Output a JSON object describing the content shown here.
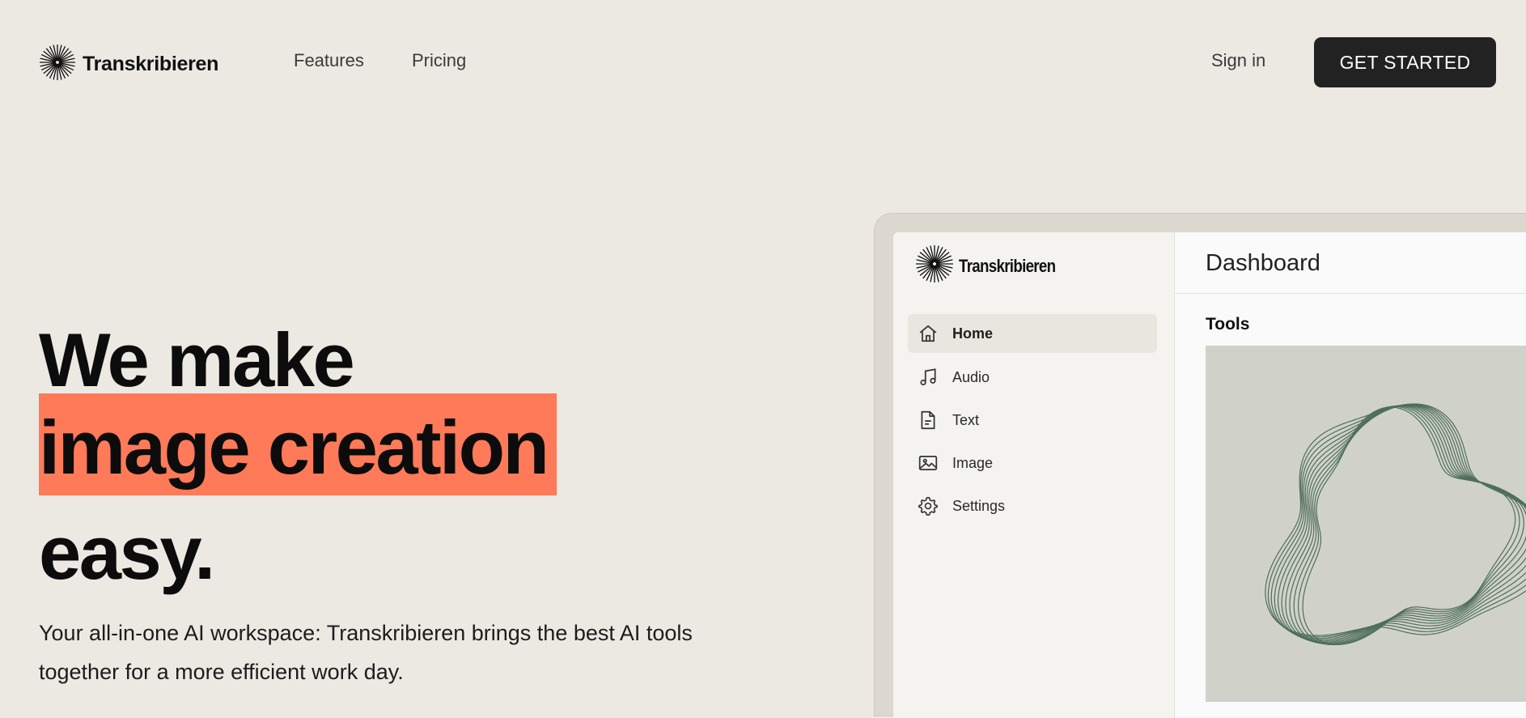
{
  "nav": {
    "brand": "Transkribieren",
    "links": [
      "Features",
      "Pricing"
    ],
    "sign_in": "Sign in",
    "cta": "GET STARTED"
  },
  "hero": {
    "line1": "We make",
    "highlight": "image creation",
    "line3": "easy.",
    "description": "Your all-in-one AI workspace: Transkribieren brings the best AI tools together for a more efficient work day.",
    "highlight_color": "#ff7a59"
  },
  "app": {
    "brand": "Transkribieren",
    "sidebar": [
      {
        "label": "Home",
        "icon": "home-icon",
        "active": true
      },
      {
        "label": "Audio",
        "icon": "music-note-icon",
        "active": false
      },
      {
        "label": "Text",
        "icon": "document-icon",
        "active": false
      },
      {
        "label": "Image",
        "icon": "image-icon",
        "active": false
      },
      {
        "label": "Settings",
        "icon": "gear-icon",
        "active": false
      }
    ],
    "header_title": "Dashboard",
    "section_title": "Tools"
  },
  "colors": {
    "background": "#ece9e2",
    "cta_bg": "#222222",
    "card_bg": "#d0d2ca",
    "wave_stroke": "#4f6e5c"
  }
}
